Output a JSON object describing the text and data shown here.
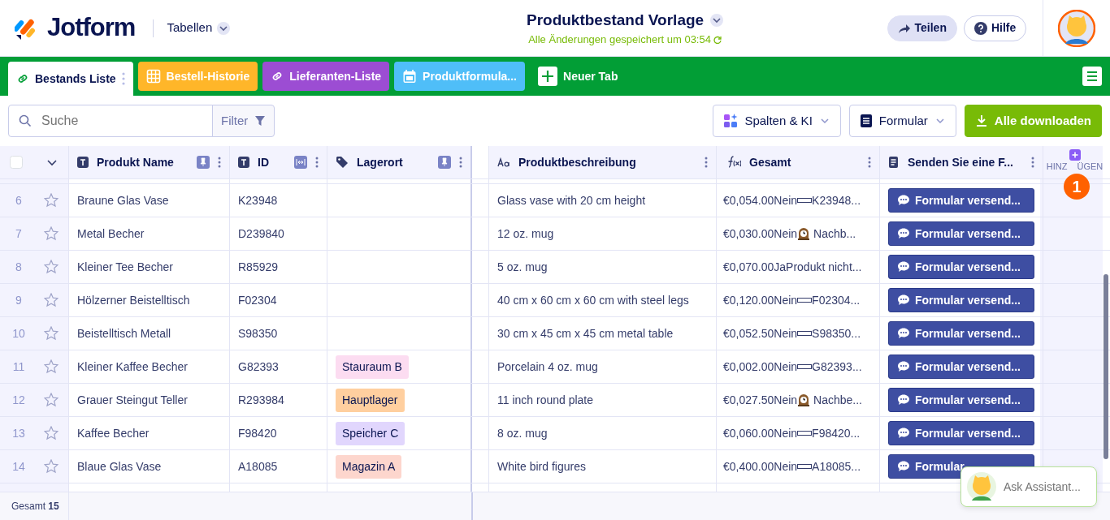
{
  "header": {
    "logo_text": "Jotform",
    "section": "Tabellen",
    "title": "Produktbestand Vorlage",
    "saved_status": "Alle Änderungen gespeichert um 03:54",
    "buttons": [
      {
        "label": "Teilen",
        "kind": "share"
      },
      {
        "label": "Hilfe",
        "kind": "help"
      }
    ]
  },
  "tabs": [
    {
      "label": "Bestands Liste",
      "color": "#ffffff",
      "selected": true
    },
    {
      "label": "Bestell-Historie",
      "color": "#ffb629",
      "selected": false
    },
    {
      "label": "Lieferanten-Liste",
      "color": "#9c4dd3",
      "selected": false
    },
    {
      "label": "Produktformula...",
      "color": "#4fbef8",
      "selected": false
    }
  ],
  "new_tab": "Neuer Tab",
  "toolbar": {
    "search": {
      "placeholder": "Suche"
    },
    "filter": "Filter",
    "columns_button": "Spalten & KI",
    "form_button": "Formular",
    "download_button": "Alle downloaden"
  },
  "select_all": {
    "checked": false
  },
  "columns": [
    {
      "label": "Produkt Name"
    },
    {
      "label": "ID"
    },
    {
      "label": "Lagerort"
    },
    {
      "label": "Produktbeschreibung"
    },
    {
      "label": "Gesamt"
    },
    {
      "label": "Senden Sie eine F..."
    }
  ],
  "add_column": {
    "label_start": "HINZ",
    "label_end": "ÜGEN",
    "badge": "1"
  },
  "rows": [
    {
      "number": "6",
      "starred": false,
      "name": "Braune Glas Vase",
      "id": "K23948",
      "description": "Glass vase with 20 cm height",
      "total": {
        "kind": "bar",
        "lead": "€0,054.00Nein",
        "rest": "K23948..."
      },
      "action": "Formular versend..."
    },
    {
      "number": "7",
      "starred": false,
      "name": "Metal Becher",
      "id": "D239840",
      "description": "12 oz. mug",
      "total": {
        "kind": "clock",
        "lead": "€0,030.00Nein",
        "rest": "Nachb..."
      },
      "action": "Formular versend..."
    },
    {
      "number": "8",
      "starred": false,
      "name": "Kleiner Tee Becher",
      "id": "R85929",
      "description": "5 oz. mug",
      "total": {
        "kind": "plain",
        "lead": "€0,070.00JaProdukt nicht..."
      },
      "action": "Formular versend..."
    },
    {
      "number": "9",
      "starred": false,
      "name": "Hölzerner Beistelltisch",
      "id": "F02304",
      "description": "40 cm x 60 cm x 60 cm with steel legs",
      "total": {
        "kind": "bar",
        "lead": "€0,120.00Nein",
        "rest": "F02304..."
      },
      "action": "Formular versend..."
    },
    {
      "number": "10",
      "starred": false,
      "name": "Beistelltisch Metall",
      "id": "S98350",
      "description": "30 cm x 45 cm x 45 cm metal table",
      "total": {
        "kind": "bar",
        "lead": "€0,052.50Nein",
        "rest": "S98350..."
      },
      "action": "Formular versend..."
    },
    {
      "number": "11",
      "starred": false,
      "name": "Kleiner Kaffee Becher",
      "id": "G82393",
      "location": {
        "text": "Stauraum B",
        "color": "#fcdcf1"
      },
      "description": "Porcelain 4 oz. mug",
      "total": {
        "kind": "bar",
        "lead": "€0,002.00Nein",
        "rest": "G82393..."
      },
      "action": "Formular versend..."
    },
    {
      "number": "12",
      "starred": false,
      "name": "Grauer Steingut Teller",
      "id": "R293984",
      "location": {
        "text": "Hauptlager",
        "color": "#ffcf9f"
      },
      "description": "11 inch round plate",
      "total": {
        "kind": "clock",
        "lead": "€0,027.50Nein",
        "rest": "Nachbe..."
      },
      "action": "Formular versend..."
    },
    {
      "number": "13",
      "starred": false,
      "name": "Kaffee Becher",
      "id": "F98420",
      "location": {
        "text": "Speicher C",
        "color": "#e1d6fd"
      },
      "description": "8 oz. mug",
      "total": {
        "kind": "bar",
        "lead": "€0,060.00Nein",
        "rest": "F98420..."
      },
      "action": "Formular versend..."
    },
    {
      "number": "14",
      "starred": false,
      "name": "Blaue Glas Vase",
      "id": "A18085",
      "location": {
        "text": "Magazin A",
        "color": "#fdd6cd"
      },
      "description": "White bird figures",
      "total": {
        "kind": "bar",
        "lead": "€0,400.00Nein",
        "rest": "A18085..."
      },
      "action": "Formular"
    }
  ],
  "footer": "Gesamt **15**",
  "assistant": {
    "placeholder": "Ask Assistant..."
  }
}
